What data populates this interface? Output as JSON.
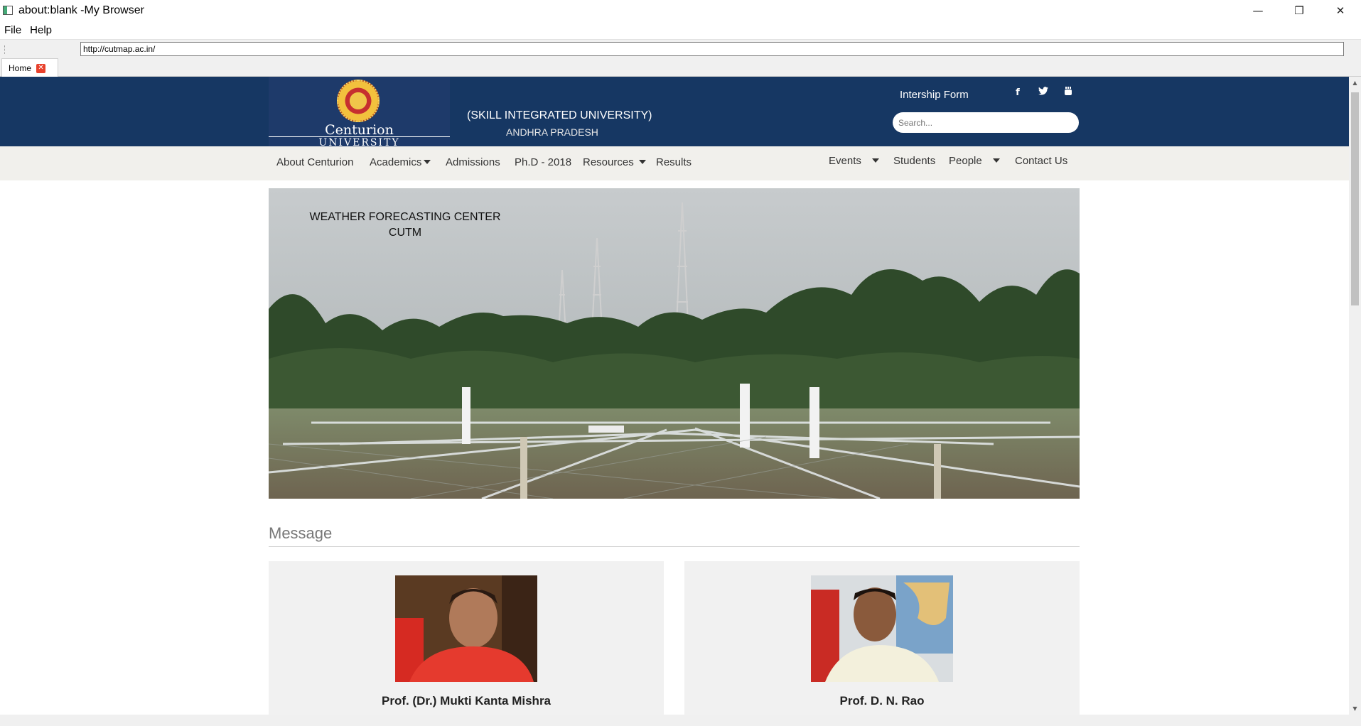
{
  "window": {
    "title": "about:blank -My Browser",
    "minimize": "—",
    "restore": "❐",
    "close": "✕"
  },
  "menu": [
    "File",
    "Help"
  ],
  "address": {
    "url": "http://cutmap.ac.in/"
  },
  "tabs": [
    {
      "label": "Home",
      "close": "✕"
    }
  ],
  "header": {
    "logo_name": "Centurion",
    "logo_sub": "UNIVERSITY",
    "tagline": "(SKILL INTEGRATED UNIVERSITY)",
    "state": "ANDHRA PRADESH",
    "internship_link": "Intership Form",
    "social": [
      {
        "icon": "facebook-icon",
        "glyph": "f"
      },
      {
        "icon": "twitter-icon",
        "glyph": "🐦"
      },
      {
        "icon": "youtube-icon",
        "glyph": "▶"
      }
    ],
    "search_placeholder": "Search..."
  },
  "nav": {
    "left": [
      "About Centurion",
      "Academics",
      "Admissions",
      "Ph.D - 2018",
      "Resources",
      "Results"
    ],
    "right": [
      "Events",
      "Students",
      "People",
      "Contact Us"
    ]
  },
  "banner": {
    "line1": "WEATHER FORECASTING CENTER",
    "line2": "CUTM"
  },
  "message": {
    "heading": "Message",
    "people": [
      {
        "name": "Prof. (Dr.) Mukti Kanta Mishra"
      },
      {
        "name": "Prof. D. N. Rao"
      }
    ]
  },
  "colors": {
    "header_bg": "#163763",
    "nav_bg": "#f1f0ec",
    "card_bg": "#f1f1f1"
  }
}
